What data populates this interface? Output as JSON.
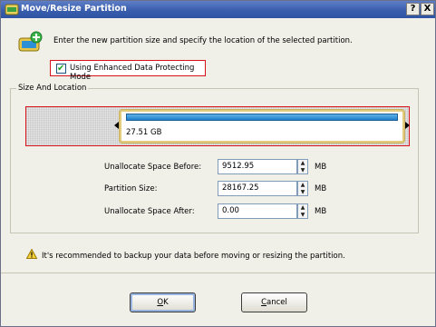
{
  "window": {
    "title": "Move/Resize Partition",
    "help_label": "?",
    "close_label": "X"
  },
  "intro_text": "Enter the new partition size and specify the location of the selected partition.",
  "option": {
    "label": "Using Enhanced Data Protecting Mode",
    "checked": true
  },
  "group": {
    "title": "Size And Location"
  },
  "partition": {
    "size_label": "27.51 GB"
  },
  "fields": [
    {
      "label": "Unallocate Space Before:",
      "value": "9512.95",
      "unit": "MB"
    },
    {
      "label": "Partition Size:",
      "value": "28167.25",
      "unit": "MB"
    },
    {
      "label": "Unallocate Space After:",
      "value": "0.00",
      "unit": "MB"
    }
  ],
  "warning": "It's recommended to backup your data before moving or resizing the partition.",
  "buttons": {
    "ok": {
      "accel": "O",
      "rest": "K"
    },
    "cancel": {
      "accel": "C",
      "rest": "ancel"
    }
  }
}
